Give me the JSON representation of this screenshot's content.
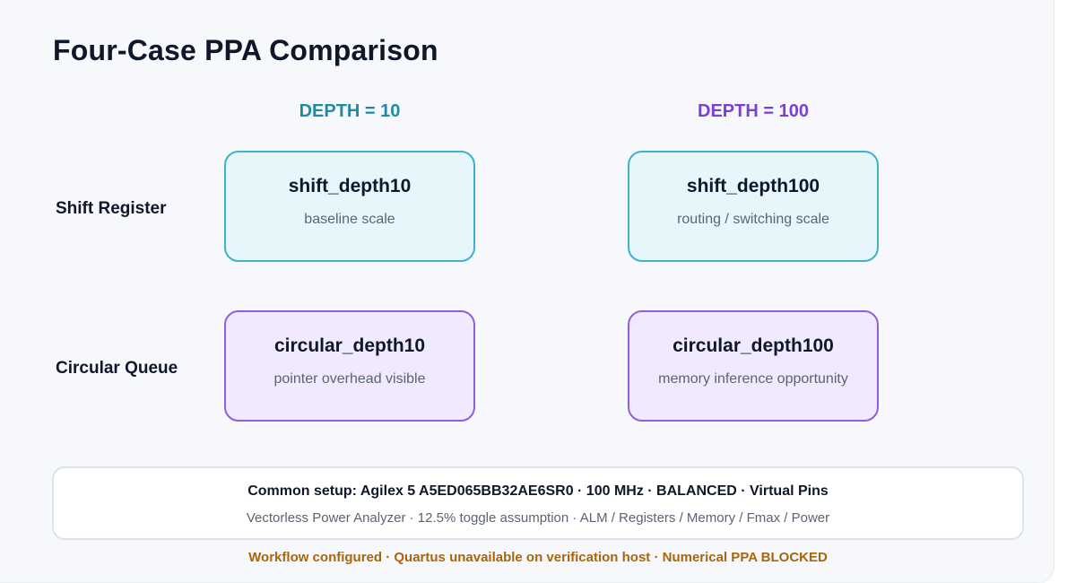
{
  "title": "Four-Case PPA Comparison",
  "columns": [
    {
      "label": "DEPTH = 10",
      "color": "#1f8aa6"
    },
    {
      "label": "DEPTH = 100",
      "color": "#7c3fd6"
    }
  ],
  "rows": [
    {
      "label": "Shift Register"
    },
    {
      "label": "Circular Queue"
    }
  ],
  "cards": [
    {
      "name": "shift_depth10",
      "desc": "baseline scale"
    },
    {
      "name": "shift_depth100",
      "desc": "routing / switching scale"
    },
    {
      "name": "circular_depth10",
      "desc": "pointer overhead visible"
    },
    {
      "name": "circular_depth100",
      "desc": "memory inference opportunity"
    }
  ],
  "setup": {
    "line1": "Common setup: Agilex 5 A5ED065BB32AE6SR0 · 100 MHz · BALANCED · Virtual Pins",
    "line2": "Vectorless Power Analyzer · 12.5% toggle assumption · ALM / Registers / Memory / Fmax / Power"
  },
  "status": "Workflow configured · Quartus unavailable on verification host · Numerical PPA BLOCKED",
  "colors": {
    "shift_fill": "#e6f6fb",
    "shift_border": "#3cb2cf",
    "circular_fill": "#f1e9fd",
    "circular_border": "#8f5fe0",
    "status": "#a8650a"
  }
}
